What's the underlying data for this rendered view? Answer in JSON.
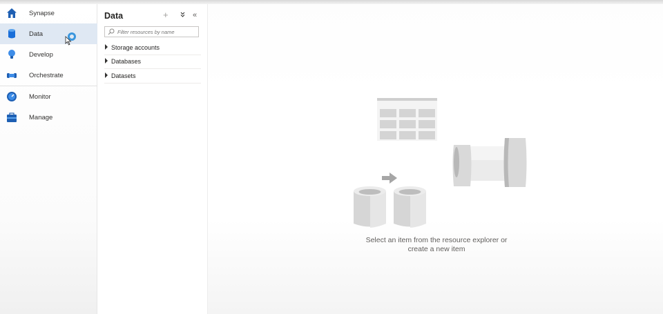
{
  "nav": {
    "items": [
      {
        "label": "Synapse",
        "icon": "home-icon"
      },
      {
        "label": "Data",
        "icon": "database-icon",
        "active": true
      },
      {
        "label": "Develop",
        "icon": "lightbulb-icon"
      },
      {
        "label": "Orchestrate",
        "icon": "pipeline-icon"
      },
      {
        "label": "Monitor",
        "icon": "monitor-gauge-icon"
      },
      {
        "label": "Manage",
        "icon": "toolbox-icon"
      }
    ]
  },
  "panel": {
    "title": "Data",
    "add_label": "+",
    "expand_label": "»",
    "collapse_label": "«",
    "filter_placeholder": "Filter resources by name",
    "tree": [
      {
        "label": "Storage accounts"
      },
      {
        "label": "Databases"
      },
      {
        "label": "Datasets"
      }
    ]
  },
  "main": {
    "empty_line1": "Select an item from the resource explorer or",
    "empty_line2": "create a new item"
  },
  "colors": {
    "accent": "#0078d4",
    "active_nav_bg": "#dfe8f3",
    "illustration_gray": "#d2d2d2"
  }
}
